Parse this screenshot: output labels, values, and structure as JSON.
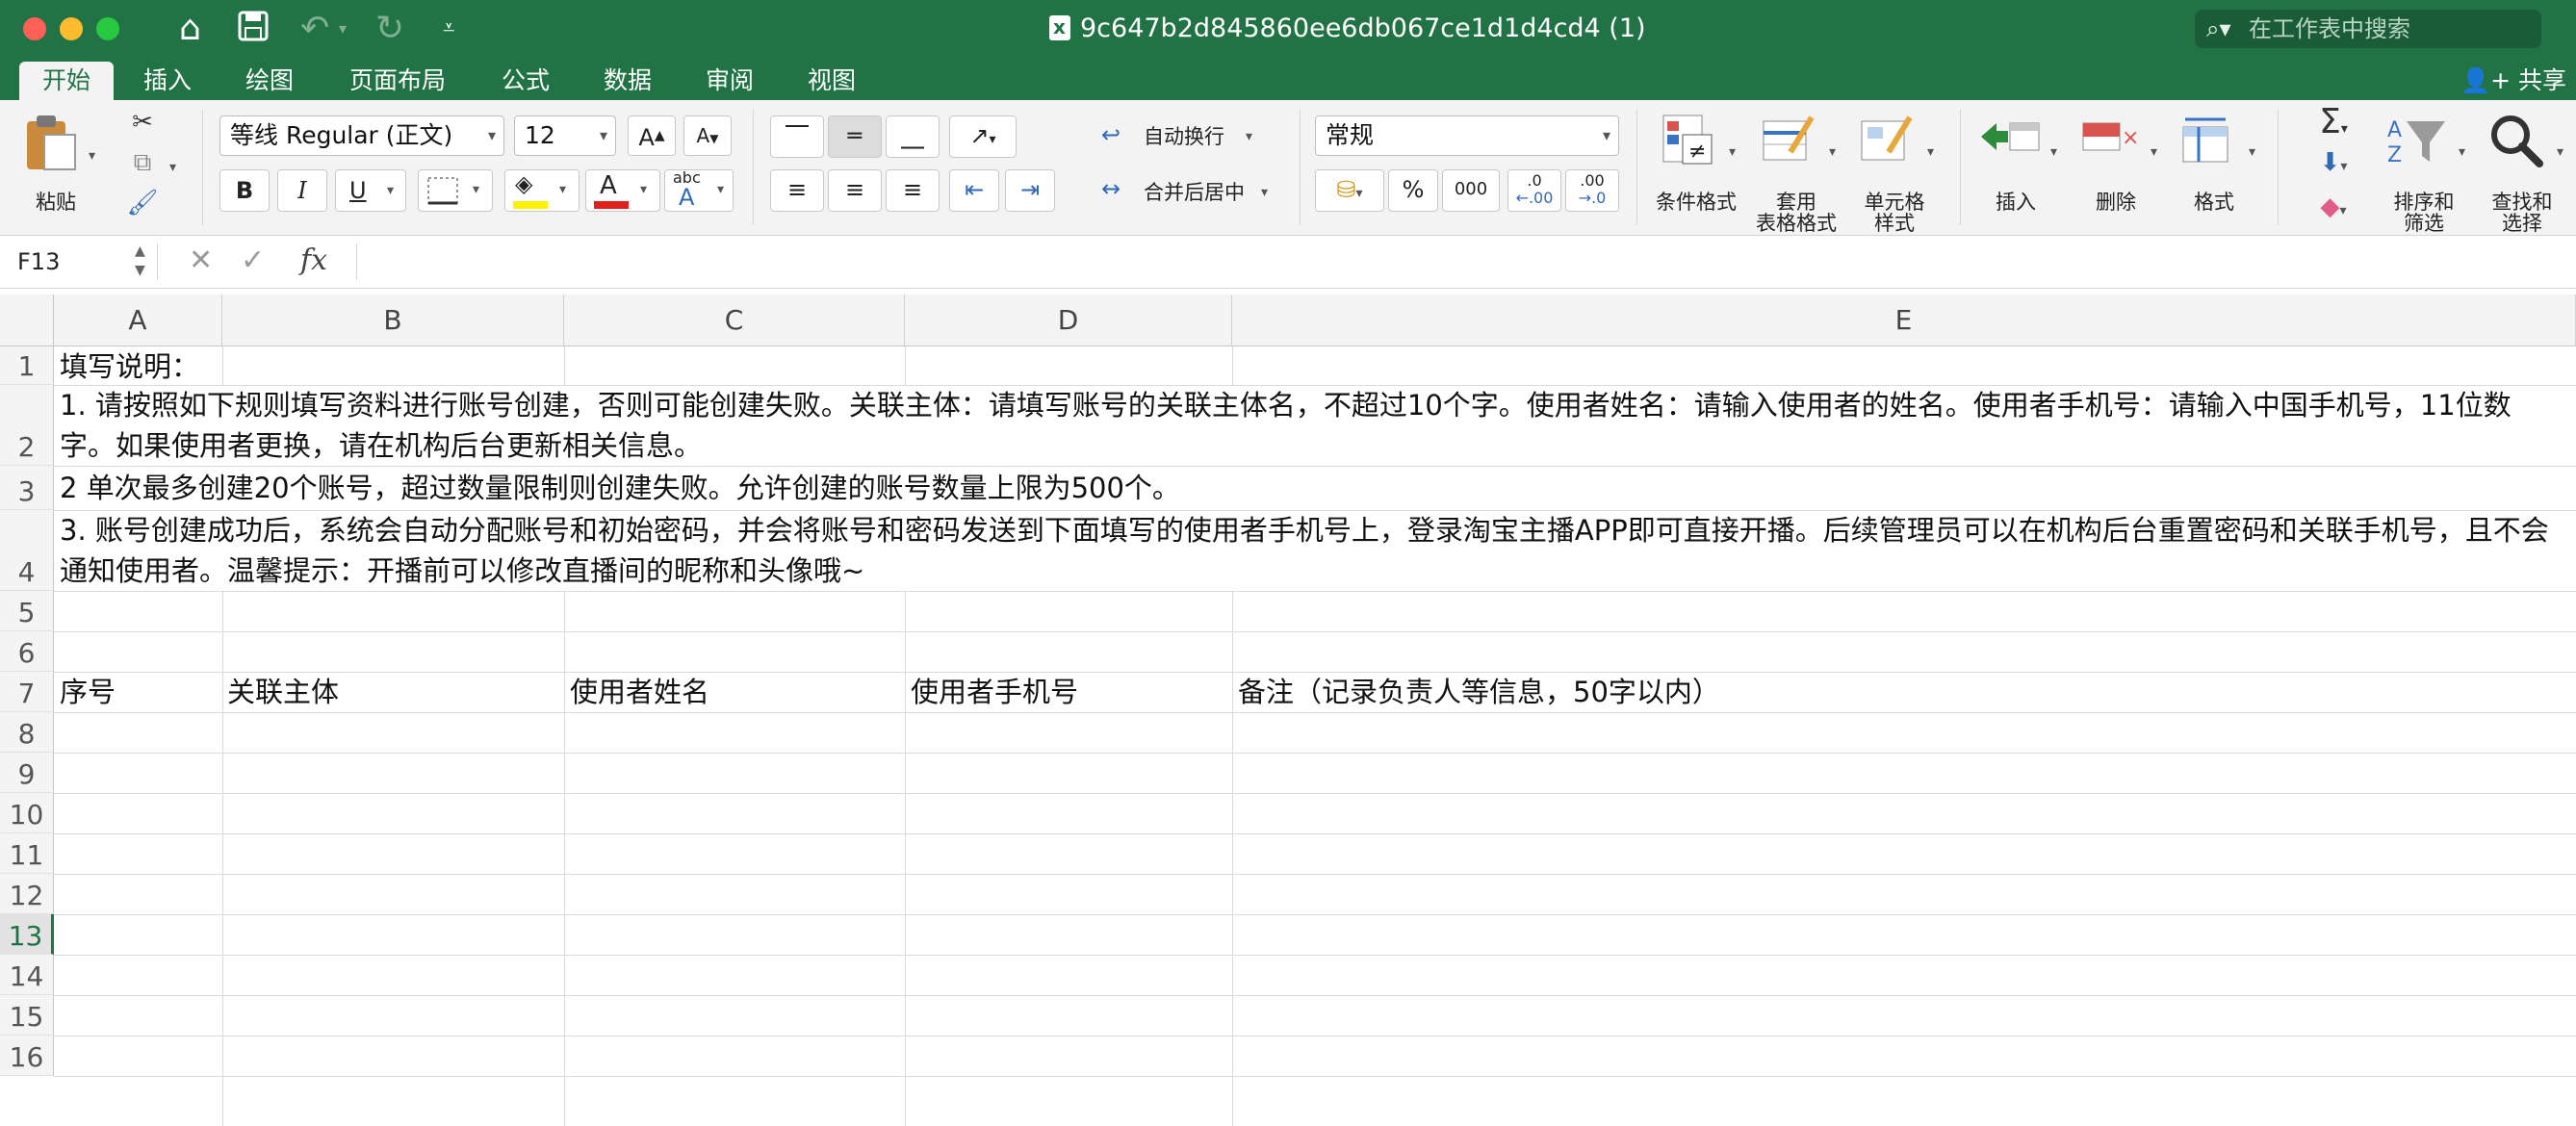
{
  "window": {
    "title": "9c647b2d845860ee6db067ce1d1d4cd4 (1)",
    "search_placeholder": "在工作表中搜索"
  },
  "quick_access": {
    "icons": [
      "home-icon",
      "save-icon",
      "undo-icon",
      "redo-icon",
      "customize-icon"
    ]
  },
  "tabs": [
    "开始",
    "插入",
    "绘图",
    "页面布局",
    "公式",
    "数据",
    "审阅",
    "视图"
  ],
  "active_tab": "开始",
  "share_label": "共享",
  "ribbon": {
    "paste_label": "粘贴",
    "font_name": "等线 Regular (正文)",
    "font_size": "12",
    "bold": "B",
    "italic": "I",
    "underline": "U",
    "wrap_text": "自动换行",
    "merge_center": "合并后居中",
    "number_format": "常规",
    "percent": "%",
    "thousands": "000",
    "inc_decimal": ".0",
    "dec_decimal": ".00",
    "conditional_format": "条件格式",
    "table_format_line1": "套用",
    "table_format_line2": "表格格式",
    "cell_style_line1": "单元格",
    "cell_style_line2": "样式",
    "insert": "插入",
    "delete": "删除",
    "format": "格式",
    "sort_filter_line1": "排序和",
    "sort_filter_line2": "筛选",
    "find_select_line1": "查找和",
    "find_select_line2": "选择",
    "sum_symbol": "Σ",
    "abc_label": "abc"
  },
  "formula_bar": {
    "name_box": "F13",
    "fx_label": "fx",
    "formula": ""
  },
  "columns": [
    "A",
    "B",
    "C",
    "D",
    "E"
  ],
  "rows": [
    "1",
    "2",
    "3",
    "4",
    "5",
    "6",
    "7",
    "8",
    "9",
    "10",
    "11",
    "12",
    "13",
    "14",
    "15",
    "16"
  ],
  "selected_row": "13",
  "cells": {
    "r1": "填写说明：",
    "r2": "1. 请按照如下规则填写资料进行账号创建，否则可能创建失败。关联主体：请填写账号的关联主体名，不超过10个字。使用者姓名：请输入使用者的姓名。使用者手机号：请输入中国手机号，11位数字。如果使用者更换，请在机构后台更新相关信息。",
    "r3": "2 单次最多创建20个账号，超过数量限制则创建失败。允许创建的账号数量上限为500个。",
    "r4": "3. 账号创建成功后，系统会自动分配账号和初始密码，并会将账号和密码发送到下面填写的使用者手机号上，登录淘宝主播APP即可直接开播。后续管理员可以在机构后台重置密码和关联手机号，且不会通知使用者。温馨提示：开播前可以修改直播间的昵称和头像哦~",
    "headers": [
      "序号",
      "关联主体",
      "使用者姓名",
      "使用者手机号",
      "备注（记录负责人等信息，50字以内）"
    ]
  },
  "colors": {
    "excel_green": "#217346",
    "ribbon_bg": "#f3f3f3",
    "font_color_red": "#e0201b",
    "highlight_yellow": "#fff200"
  }
}
